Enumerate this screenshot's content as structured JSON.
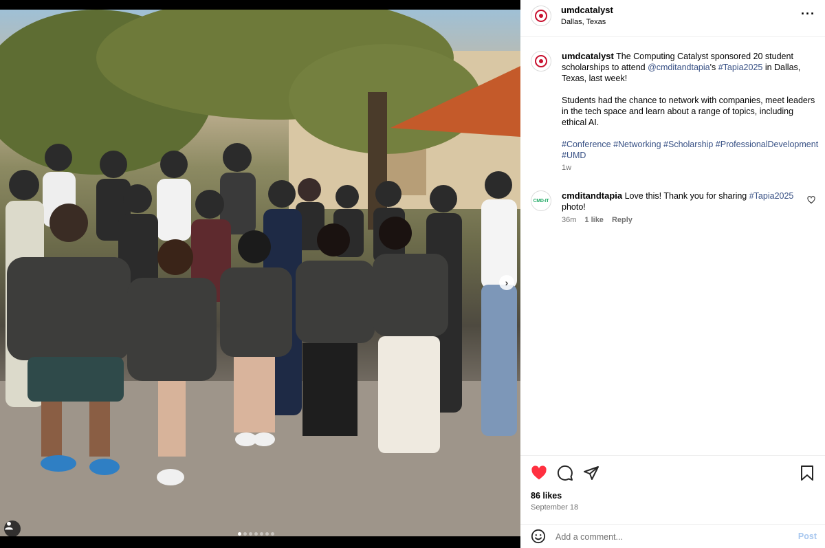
{
  "post": {
    "author": "umdcatalyst",
    "location": "Dallas, Texas",
    "caption": {
      "author": "umdcatalyst",
      "intro": "The Computing Catalyst sponsored 20 student scholarships to attend ",
      "mention": "@cmditandtapia",
      "possessive": "'s ",
      "hashtag1": "#Tapia2025",
      "intro_end": " in Dallas, Texas, last week!",
      "paragraph2": "Students had the chance to network with companies, meet leaders in the tech space and learn about a range of topics, including ethical AI.",
      "tags": [
        "#Conference",
        "#Networking",
        "#Scholarship",
        "#ProfessionalDevelopment",
        "#UMD"
      ],
      "time": "1w"
    },
    "comments": [
      {
        "author": "cmditandtapia",
        "text_before": "Love this! Thank you for sharing ",
        "hashtag": "#Tapia2025",
        "text_after": " photo!",
        "time": "36m",
        "likes": "1 like",
        "reply": "Reply"
      }
    ],
    "likes": "86 likes",
    "date": "September 18",
    "add_comment_placeholder": "Add a comment...",
    "post_label": "Post",
    "carousel": {
      "total": 7,
      "active": 0
    }
  },
  "colors": {
    "like_red": "#ff3040",
    "link_blue": "#385185",
    "post_blue": "#a7c7ef",
    "brand_red": "#c8102e"
  },
  "icons": [
    "more-icon",
    "heart-icon",
    "comment-icon",
    "share-icon",
    "bookmark-icon",
    "emoji-icon",
    "user-tag-icon",
    "chevron-right-icon"
  ]
}
